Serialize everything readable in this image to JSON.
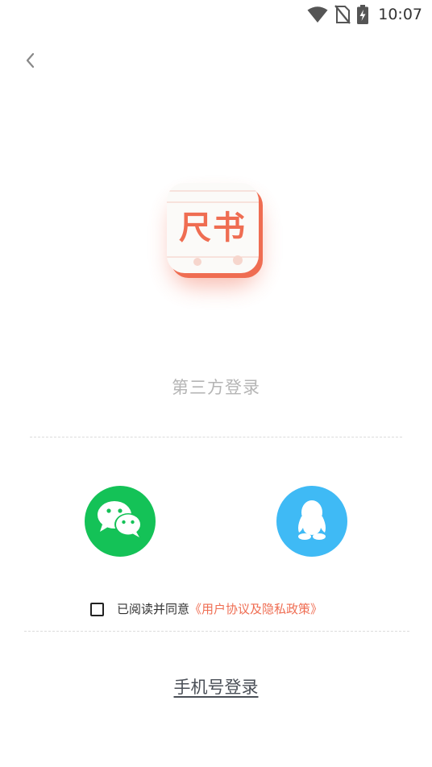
{
  "status_bar": {
    "time": "10:07",
    "icons": [
      "wifi-icon",
      "no-sim-icon",
      "battery-charging-icon"
    ]
  },
  "header": {
    "back_icon": "chevron-left-icon"
  },
  "logo": {
    "text": "尺书",
    "brand_color": "#ef6d52"
  },
  "login": {
    "section_title": "第三方登录",
    "providers": [
      {
        "name": "wechat",
        "icon": "wechat-icon",
        "color": "#14c257"
      },
      {
        "name": "qq",
        "icon": "qq-penguin-icon",
        "color": "#3fbaf5"
      }
    ],
    "agreement_prefix": "已阅读并同意",
    "agreement_link": "《用户协议及隐私政策》",
    "phone_login_label": "手机号登录"
  },
  "colors": {
    "accent": "#ef6d52",
    "wechat": "#14c257",
    "qq": "#3fbaf5",
    "muted_text": "#b5b5b5"
  }
}
